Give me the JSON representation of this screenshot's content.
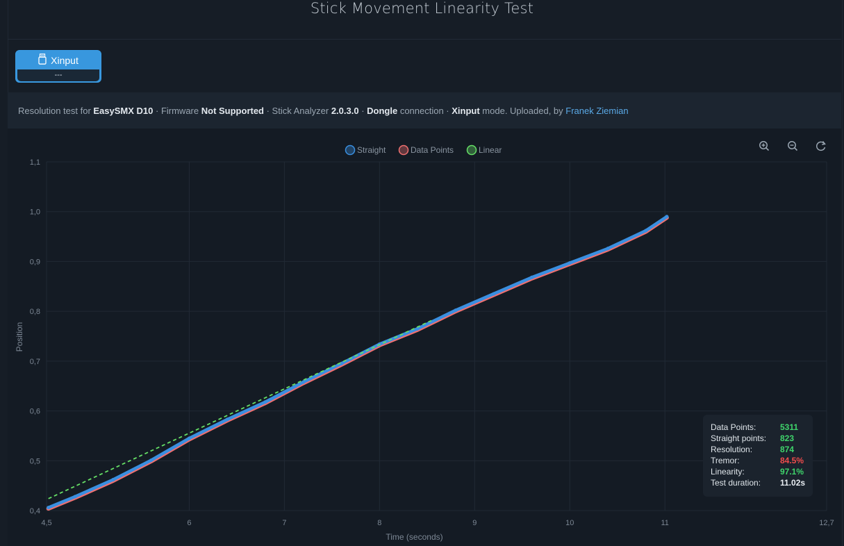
{
  "page": {
    "title": "Stick Movement Linearity Test"
  },
  "mode_button": {
    "label": "Xinput",
    "sub_label": "---",
    "icon": "usb-drive-icon",
    "color": "#3897de"
  },
  "info_bar": {
    "prefix": "Resolution test for ",
    "device": "EasySMX D10",
    "sep1": " · Firmware ",
    "firmware": "Not Supported",
    "sep2": " · Stick Analyzer ",
    "version": "2.0.3.0",
    "sep3": " · ",
    "connection": "Dongle",
    "sep4": " connection · ",
    "mode": "Xinput",
    "sep5": " mode. Uploaded, by ",
    "uploader": "Franek Ziemian"
  },
  "toolbar": {
    "zoom_in_icon": "zoom-in-icon",
    "zoom_out_icon": "zoom-out-icon",
    "reset_icon": "reset-zoom-icon"
  },
  "stats": {
    "rows": [
      {
        "label": "Data Points:",
        "value": "5311",
        "color": "#3fd46b"
      },
      {
        "label": "Straight points:",
        "value": "823",
        "color": "#3fd46b"
      },
      {
        "label": "Resolution:",
        "value": "874",
        "color": "#3fd46b"
      },
      {
        "label": "Tremor:",
        "value": "84.5%",
        "color": "#ef4c4c"
      },
      {
        "label": "Linearity:",
        "value": "97.1%",
        "color": "#3fd46b"
      },
      {
        "label": "Test duration:",
        "value": "11.02s",
        "color": "#e8edf2"
      }
    ]
  },
  "chart_data": {
    "type": "line",
    "xlabel": "Time (seconds)",
    "ylabel": "Position",
    "xlim": [
      4.5,
      12.7
    ],
    "ylim": [
      0.4,
      1.1
    ],
    "x_ticks": [
      {
        "value": 4.5,
        "label": "4,5"
      },
      {
        "value": 6,
        "label": "6"
      },
      {
        "value": 7,
        "label": "7"
      },
      {
        "value": 8,
        "label": "8"
      },
      {
        "value": 9,
        "label": "9"
      },
      {
        "value": 10,
        "label": "10"
      },
      {
        "value": 11,
        "label": "11"
      },
      {
        "value": 12.7,
        "label": "12,7"
      }
    ],
    "y_ticks": [
      {
        "value": 0.4,
        "label": "0,4"
      },
      {
        "value": 0.5,
        "label": "0,5"
      },
      {
        "value": 0.6,
        "label": "0,6"
      },
      {
        "value": 0.7,
        "label": "0,7"
      },
      {
        "value": 0.8,
        "label": "0,8"
      },
      {
        "value": 0.9,
        "label": "0,9"
      },
      {
        "value": 1.0,
        "label": "1,0"
      },
      {
        "value": 1.1,
        "label": "1,1"
      }
    ],
    "grid": true,
    "legend_position": "top-center",
    "series": [
      {
        "name": "Straight",
        "color": "#3a8fe0",
        "x": [
          4.52,
          4.8,
          5.2,
          5.6,
          6.0,
          6.4,
          6.8,
          7.2,
          7.6,
          8.0,
          8.4,
          8.8,
          9.2,
          9.6,
          10.0,
          10.4,
          10.8,
          11.02
        ],
        "y": [
          0.406,
          0.428,
          0.462,
          0.501,
          0.545,
          0.583,
          0.618,
          0.658,
          0.695,
          0.734,
          0.765,
          0.802,
          0.835,
          0.868,
          0.897,
          0.926,
          0.962,
          0.99
        ]
      },
      {
        "name": "Data Points",
        "color": "#f07070",
        "x": [
          4.52,
          4.8,
          5.2,
          5.6,
          6.0,
          6.4,
          6.8,
          7.2,
          7.6,
          8.0,
          8.4,
          8.8,
          9.2,
          9.6,
          10.0,
          10.4,
          10.8,
          11.02
        ],
        "y": [
          0.404,
          0.426,
          0.46,
          0.499,
          0.543,
          0.581,
          0.616,
          0.656,
          0.693,
          0.732,
          0.763,
          0.8,
          0.833,
          0.866,
          0.895,
          0.924,
          0.96,
          0.988
        ]
      },
      {
        "name": "Linear",
        "color": "#66e066",
        "x": [
          4.52,
          8.55
        ],
        "y": [
          0.424,
          0.782
        ]
      }
    ]
  }
}
